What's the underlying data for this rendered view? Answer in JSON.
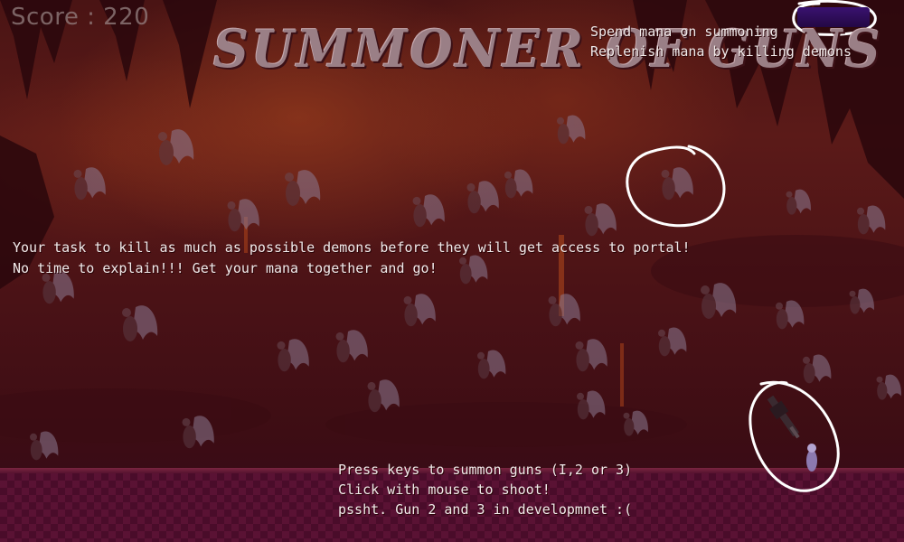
{
  "hud": {
    "score": "Score : 220",
    "title": "SUMMONER OF GUNS",
    "mana_color": "#2e0b4a",
    "mana_level": 1.0
  },
  "hints": {
    "mana_lines": [
      "Spend mana on summoning",
      "Replenish mana by killing demons"
    ],
    "task_lines": [
      "Your task to kill as much as possible demons before they will get access to portal!",
      "No time to explain!!! Get your mana together and go!"
    ],
    "control_lines": [
      "Press keys to summon guns (I,2 or 3)",
      "Click with mouse to shoot!",
      "pssht. Gun 2 and 3 in developmnet :("
    ]
  },
  "colors": {
    "background": "#4a1414",
    "floor": "#4a0c2a",
    "text": "#f1eaea",
    "title": "#9a7f86",
    "annotation_circle": "#ffffff"
  },
  "sprites": {
    "enemy_icon": "winged-demon-icon",
    "player_icon": "summoner-icon",
    "gun_icon": "gun-icon"
  }
}
